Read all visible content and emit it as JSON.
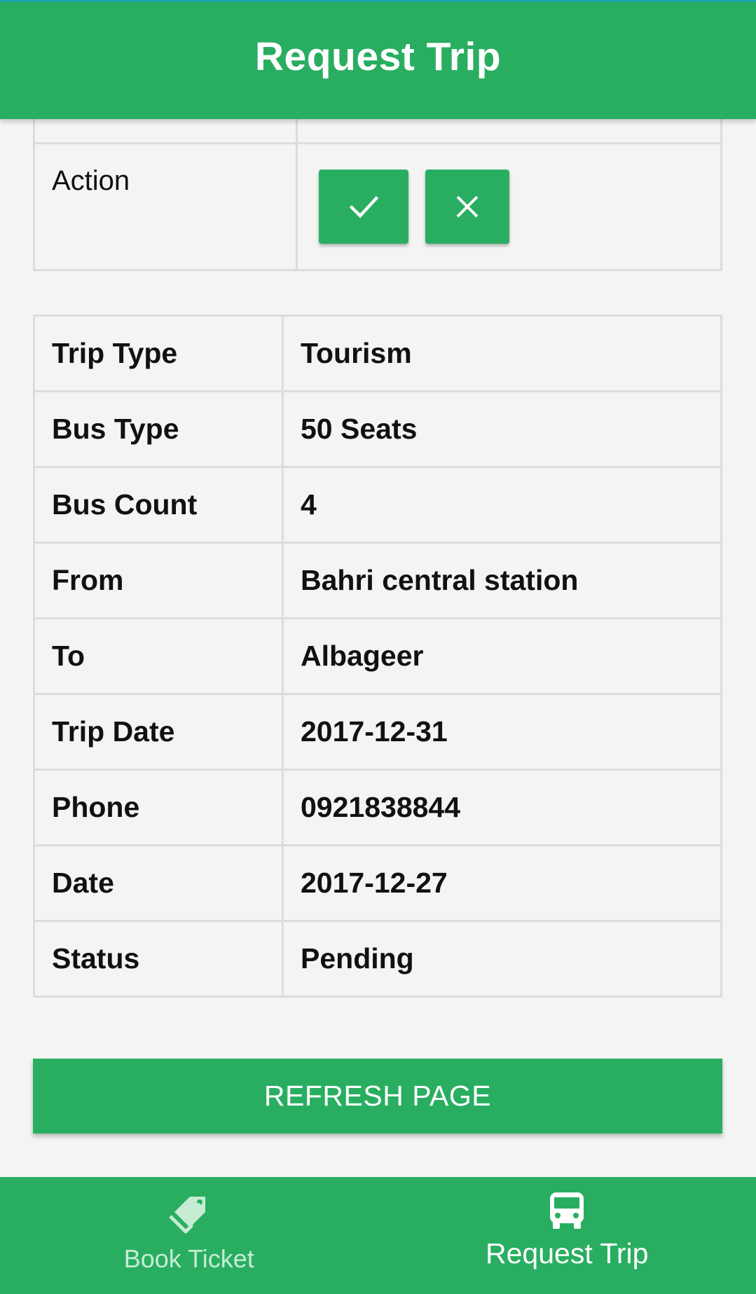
{
  "header": {
    "title": "Request Trip"
  },
  "action_row": {
    "label": "Action",
    "accept_icon": "checkmark-icon",
    "reject_icon": "close-icon"
  },
  "details": {
    "rows": [
      {
        "label": "Trip Type",
        "value": "Tourism"
      },
      {
        "label": "Bus Type",
        "value": "50 Seats"
      },
      {
        "label": "Bus Count",
        "value": "4"
      },
      {
        "label": "From",
        "value": "Bahri central station"
      },
      {
        "label": "To",
        "value": "Albageer"
      },
      {
        "label": "Trip Date",
        "value": "2017-12-31"
      },
      {
        "label": "Phone",
        "value": "0921838844"
      },
      {
        "label": "Date",
        "value": "2017-12-27"
      },
      {
        "label": "Status",
        "value": "Pending"
      }
    ]
  },
  "refresh_button": {
    "label": "REFRESH PAGE"
  },
  "bottom_nav": {
    "items": [
      {
        "label": "Book Ticket",
        "icon": "tag-icon",
        "active": false
      },
      {
        "label": "Request Trip",
        "icon": "bus-icon",
        "active": true
      }
    ]
  },
  "colors": {
    "primary": "#29ae61",
    "accent_strip": "#1ba3a7",
    "background": "#f4f4f4",
    "border": "#dcdcdc"
  }
}
